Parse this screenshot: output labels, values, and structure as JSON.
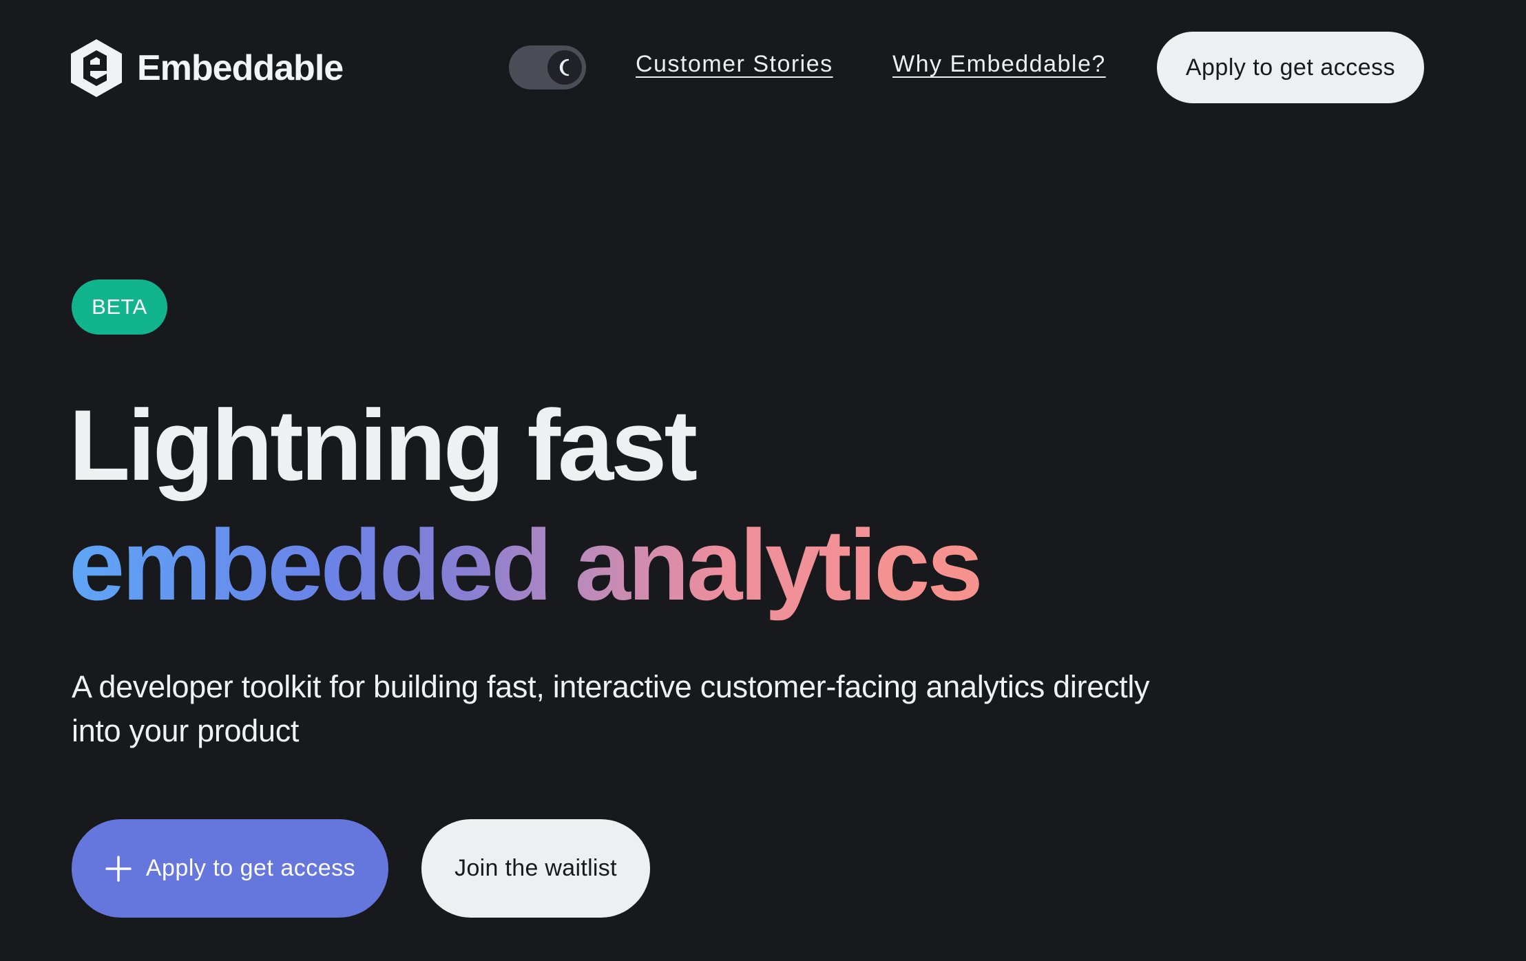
{
  "brand": {
    "name": "Embeddable",
    "logo_icon": "hexagon-e-logo-icon"
  },
  "header": {
    "theme_toggle": {
      "icon": "moon-icon",
      "mode": "dark"
    },
    "nav": [
      {
        "label": "Customer Stories"
      },
      {
        "label": "Why Embeddable?"
      }
    ],
    "cta_label": "Apply to get access"
  },
  "hero": {
    "badge": "BETA",
    "headline_line1": "Lightning fast",
    "headline_line2": "embedded analytics",
    "subtitle": "A developer toolkit for building fast, interactive customer-facing analytics directly into your product",
    "primary_button": {
      "label": "Apply to get access",
      "icon": "plus-icon"
    },
    "secondary_button": {
      "label": "Join the waitlist"
    }
  },
  "colors": {
    "background": "#18191d",
    "text": "#eeeff1",
    "badge": "#12b48e",
    "primary_button": "#6577dc",
    "secondary_button": "#eeeff1",
    "toggle_track": "#4b4e57",
    "gradient_start": "#5fa6f6",
    "gradient_mid": "#8a7fd2",
    "gradient_end": "#f7938d"
  }
}
